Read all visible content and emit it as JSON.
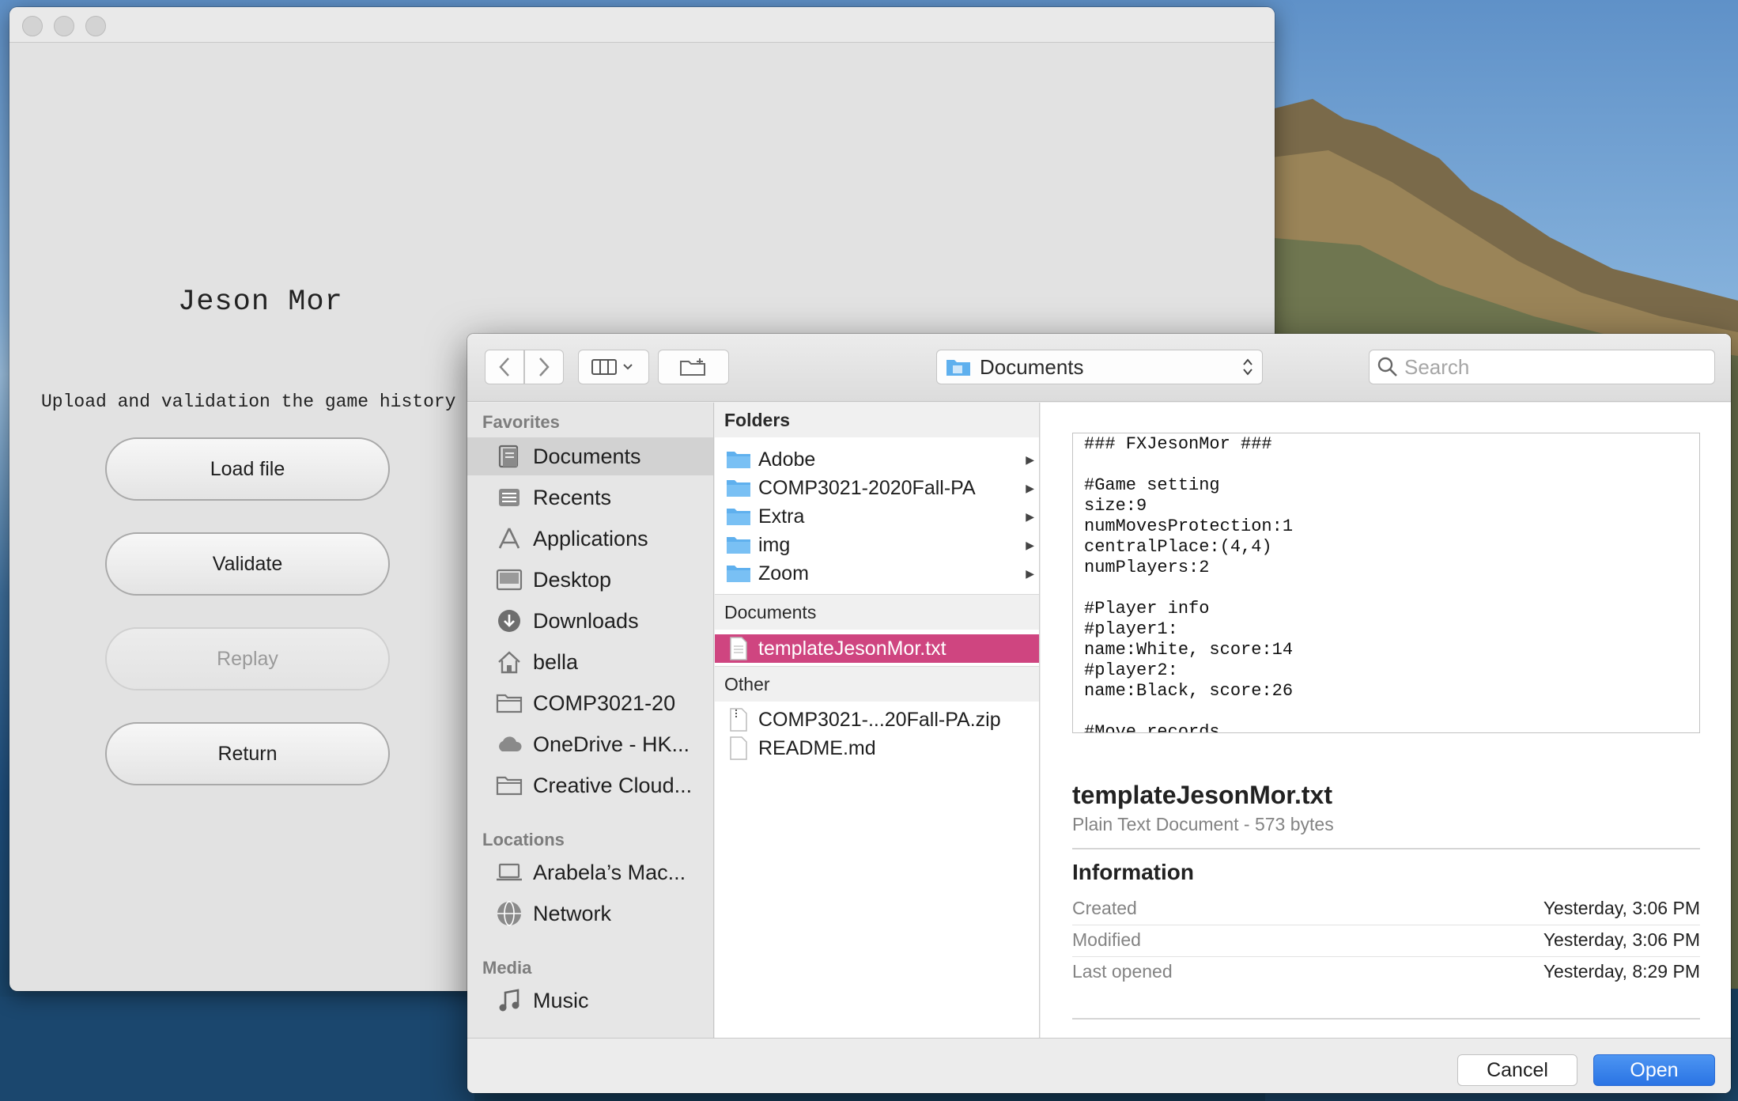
{
  "app": {
    "title": "Jeson Mor",
    "subtitle": "Upload and validation the game history",
    "buttons": {
      "load": "Load file",
      "validate": "Validate",
      "replay": "Replay",
      "return": "Return"
    }
  },
  "dialog": {
    "location": "Documents",
    "search_placeholder": "Search",
    "sidebar": {
      "favorites_heading": "Favorites",
      "favorites": [
        {
          "label": "Documents",
          "icon": "documents-icon",
          "selected": true
        },
        {
          "label": "Recents",
          "icon": "recents-icon"
        },
        {
          "label": "Applications",
          "icon": "applications-icon"
        },
        {
          "label": "Desktop",
          "icon": "desktop-icon"
        },
        {
          "label": "Downloads",
          "icon": "downloads-icon"
        },
        {
          "label": "bella",
          "icon": "home-icon"
        },
        {
          "label": "COMP3021-20",
          "icon": "folder-icon"
        },
        {
          "label": "OneDrive - HK...",
          "icon": "cloud-icon"
        },
        {
          "label": "Creative Cloud...",
          "icon": "folder-icon"
        }
      ],
      "locations_heading": "Locations",
      "locations": [
        {
          "label": "Arabela’s Mac...",
          "icon": "laptop-icon"
        },
        {
          "label": "Network",
          "icon": "network-icon"
        }
      ],
      "media_heading": "Media",
      "media": [
        {
          "label": "Music",
          "icon": "music-icon"
        }
      ]
    },
    "column": {
      "folders_heading": "Folders",
      "folders": [
        "Adobe",
        "COMP3021-2020Fall-PA",
        "Extra",
        "img",
        "Zoom"
      ],
      "documents_heading": "Documents",
      "documents": [
        "templateJesonMor.txt"
      ],
      "other_heading": "Other",
      "other": [
        "COMP3021-...20Fall-PA.zip",
        "README.md"
      ]
    },
    "preview": {
      "text": "### FXJesonMor ###\n\n#Game setting\nsize:9\nnumMovesProtection:1\ncentralPlace:(4,4)\nnumPlayers:2\n\n#Player info\n#player1:\nname:White, score:14\n#player2:\nname:Black, score:26\n\n#Move records",
      "file_name": "templateJesonMor.txt",
      "kind": "Plain Text Document - 573 bytes",
      "info_heading": "Information",
      "info": [
        {
          "label": "Created",
          "value": "Yesterday, 3:06 PM"
        },
        {
          "label": "Modified",
          "value": "Yesterday, 3:06 PM"
        },
        {
          "label": "Last opened",
          "value": "Yesterday, 8:29 PM"
        }
      ]
    },
    "footer": {
      "cancel": "Cancel",
      "open": "Open"
    }
  },
  "colors": {
    "selection": "#cf4580",
    "accent": "#2a74e4",
    "folder": "#5fb0ee"
  }
}
